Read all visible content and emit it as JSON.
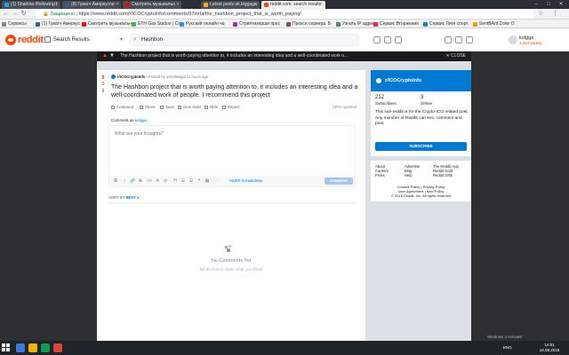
{
  "browser": {
    "tabs": [
      {
        "label": "(1) Sharlota #following | ",
        "favicon_color": "#1da1f2"
      },
      {
        "label": "(8) Гувагч Амеркуспи",
        "favicon_color": "#3b5998"
      },
      {
        "label": "Смотреть музыкальн",
        "favicon_color": "#ff0000"
      },
      {
        "label": "Latest posts uk.bigguga",
        "favicon_color": "#f4b400"
      },
      {
        "label": "reddit.com: search results",
        "favicon_color": "#ff4500"
      }
    ],
    "window_controls": [
      "–",
      "□",
      "✕"
    ],
    "secure_label": "Защищено",
    "url": "https://www.reddit.com/r/ICOCryptoInfo/comments/97mrbt/the_hashbon_project_that_is_worth_paying/"
  },
  "bookmarks": [
    {
      "label": "Сервисы",
      "color": "#888888"
    },
    {
      "label": "(1) Гувагч Амеркус",
      "color": "#3b5998"
    },
    {
      "label": "Смотреть музыкальн",
      "color": "#ff0000"
    },
    {
      "label": "ETH Gas Station | Co",
      "color": "#4caf50"
    },
    {
      "label": "Русский онлайн ча",
      "color": "#2196f3"
    },
    {
      "label": "Стриптизёрши прос",
      "color": "#9c27b0"
    },
    {
      "label": "Прокси сервера. Б",
      "color": "#795548"
    },
    {
      "label": "Узнать IP адрес",
      "color": "#607d8b"
    },
    {
      "label": "Сервис Вторжения",
      "color": "#e91e63"
    },
    {
      "label": "Сервис Лиги спорт",
      "color": "#009688"
    },
    {
      "label": "SentBArd Zone O",
      "color": "#ff9800"
    }
  ],
  "reddit_header": {
    "wordmark": "reddit",
    "subreddit_select": "Search Results",
    "search_value": "Hashbon",
    "username": "kolgga",
    "karma": "1,414 karma"
  },
  "postbar": {
    "title": "The Hashbon project that is worth paying attention to, it includes an interesting idea and a well-coordinated work o...",
    "close_label": "CLOSE"
  },
  "post": {
    "vote_count": "1",
    "subreddit": "r/ICOCryptoInfo",
    "meta": "• Posted by u/Hellsetgul 11 hours ago",
    "title": "The Hashbon project that is worth paying attention to, it includes an interesting idea and a well-coordinated work of people. I recommend this project",
    "actions": [
      {
        "label": "Comment"
      },
      {
        "label": "Share"
      },
      {
        "label": "Save"
      },
      {
        "label": "Give Gold"
      },
      {
        "label": "Hide"
      },
      {
        "label": "Report"
      }
    ],
    "upvoted": "100% Upvoted"
  },
  "comment_box": {
    "comment_as_prefix": "Comment as",
    "comment_as_user": "kolgga",
    "placeholder": "What are your thoughts?",
    "switch_markdown": "Switch to markdown",
    "submit": "COMMENT",
    "tools": [
      "B",
      "i",
      "🔗",
      "S",
      "<>",
      "A",
      "⊘",
      "H",
      "☰",
      "☰",
      "❝",
      "▦",
      "⋯"
    ]
  },
  "sort": {
    "label": "SORT BY",
    "value": "BEST"
  },
  "empty_state": {
    "title": "No Comments Yet",
    "subtitle": "Be the first to share what you think!"
  },
  "sidebar": {
    "subreddit": "r/ICOCryptoInfo",
    "subscribers_value": "212",
    "subscribers_label": "Subscribers",
    "online_value": "3",
    "online_label": "Online",
    "description": "This sub-reddit is for the Crypto-ICO related post. Any member of Reddit can see, comment and post.",
    "subscribe_label": "SUBSCRIBE",
    "footer_links": {
      "col1": [
        "About",
        "Careers",
        "Press"
      ],
      "col2": [
        "Advertise",
        "Blog",
        "Help"
      ],
      "col3": [
        "The Reddit App",
        "Reddit Gold",
        "Reddit Gifts"
      ]
    },
    "legal": [
      "Content Policy | Privacy Policy",
      "User Agreement | Mod Policy",
      "© 2018 Reddit, Inc. All rights reserved"
    ]
  },
  "taskbar": {
    "apps": [
      {
        "color": "#3c78d8"
      },
      {
        "color": "#f4b400"
      },
      {
        "color": "#0f9d58"
      },
      {
        "color": "#db4437"
      }
    ],
    "lang": "ENG",
    "time": "14:51",
    "date": "16.08.2018",
    "watermark": "Windows 4 Activate"
  }
}
